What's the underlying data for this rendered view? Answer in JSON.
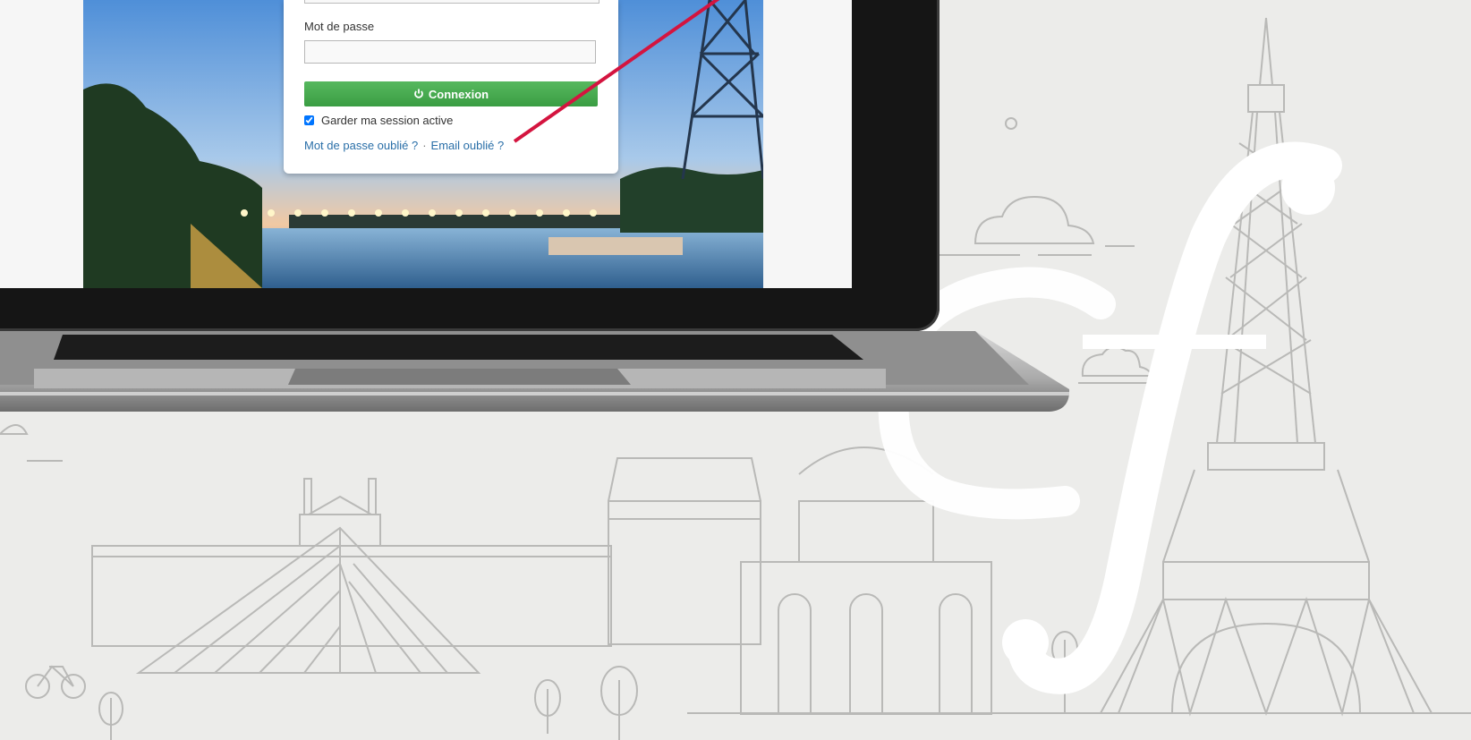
{
  "login": {
    "password_label": "Mot de passe",
    "password_value": "",
    "login_button": "Connexion",
    "keep_session_label": "Garder ma session active",
    "keep_session_checked": true,
    "forgot_password_link": "Mot de passe oublié ?",
    "separator": "·",
    "forgot_email_link": "Email oublié ?"
  },
  "colors": {
    "background": "#ececea",
    "button_green": "#45a84d",
    "link_blue": "#2a6fa8",
    "pointer_red": "#d4143f",
    "outline_grey": "#b9b9b7"
  },
  "icons": [
    "power-icon",
    "checkbox-checked-icon",
    "af-logo",
    "eiffel-tower-illustration",
    "louvre-illustration",
    "bicycle-icon",
    "tree-icon",
    "cloud-icon"
  ]
}
